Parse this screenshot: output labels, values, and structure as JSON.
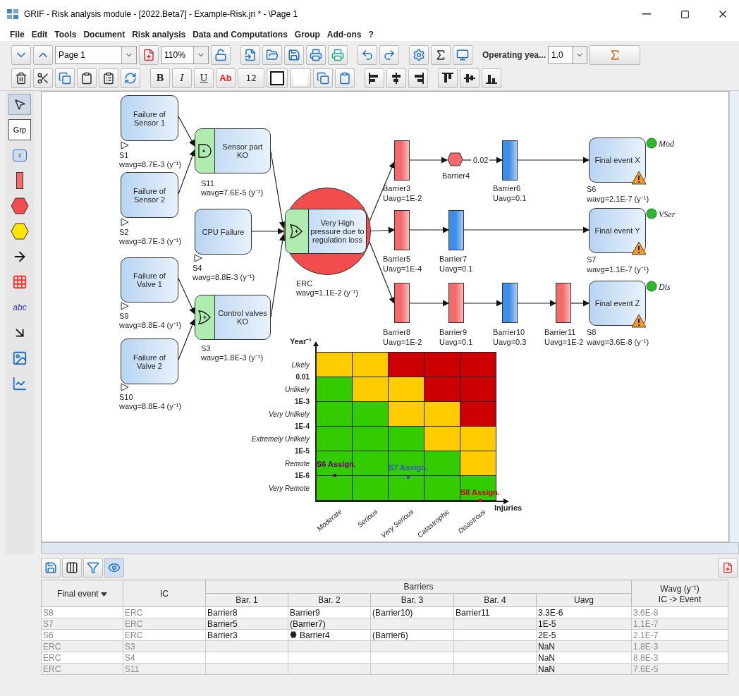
{
  "window": {
    "title": "GRIF - Risk analysis module - [2022.Beta7] - Example-Risk.jri *  - \\Page 1"
  },
  "menu": [
    "File",
    "Edit",
    "Tools",
    "Document",
    "Risk analysis",
    "Data and Computations",
    "Group",
    "Add-ons",
    "?"
  ],
  "toolbar": {
    "page": "Page 1",
    "zoom": "110%",
    "operating_label": "Operating yea...",
    "operating_value": "1.0",
    "bold": "B",
    "italic": "I",
    "underline": "U",
    "text_color": "Ab",
    "font_size": "12"
  },
  "palette": {
    "group": "Grp",
    "block": "1",
    "text": "abc"
  },
  "diagram": {
    "events": [
      {
        "title": "Failure of Sensor 1",
        "id_label": "S1",
        "value": "wavg=8.7E-3 (y⁻¹)"
      },
      {
        "title": "Failure of Sensor 2",
        "id_label": "S2",
        "value": "wavg=8.7E-3 (y⁻¹)"
      },
      {
        "title": "CPU Failure",
        "id_label": "S4",
        "value": "wavg=8.8E-3 (y⁻¹)"
      },
      {
        "title": "Failure of Valve 1",
        "id_label": "S9",
        "value": "wavg=8.8E-4 (y⁻¹)"
      },
      {
        "title": "Failure of Valve 2",
        "id_label": "S10",
        "value": "wavg=8.8E-4 (y⁻¹)"
      }
    ],
    "gates": [
      {
        "title": "Sensor part KO",
        "id_label": "S11",
        "value": "wavg=7.6E-5 (y⁻¹)",
        "kind": "and"
      },
      {
        "title": "Control valves KO",
        "id_label": "S3",
        "value": "wavg=1.8E-3 (y⁻¹)",
        "kind": "or"
      }
    ],
    "central_event": {
      "title": "Very High pressure due to regulation loss",
      "id_label": "ERC",
      "value": "wavg=1.1E-2 (y⁻¹)",
      "kind": "or"
    },
    "barriers": [
      {
        "name": "Barrier3",
        "value": "Uavg=1E-2",
        "kind": "rect",
        "color": "#f26b6b"
      },
      {
        "name": "Barrier4",
        "kind": "hexagon",
        "color": "#f26b6b",
        "edge_label": "0.02"
      },
      {
        "name": "Barrier6",
        "value": "Uavg=0.1",
        "kind": "rect",
        "color": "#3d8ee8"
      },
      {
        "name": "Barrier5",
        "value": "Uavg=1E-4",
        "kind": "rect",
        "color": "#f26b6b"
      },
      {
        "name": "Barrier7",
        "value": "Uavg=0.1",
        "kind": "rect",
        "color": "#3d8ee8"
      },
      {
        "name": "Barrier8",
        "value": "Uavg=1E-2",
        "kind": "rect",
        "color": "#f26b6b"
      },
      {
        "name": "Barrier9",
        "value": "Uavg=0.1",
        "kind": "rect",
        "color": "#f26b6b"
      },
      {
        "name": "Barrier10",
        "value": "Uavg=0.3",
        "kind": "rect",
        "color": "#3d8ee8"
      },
      {
        "name": "Barrier11",
        "value": "Uavg=1E-2",
        "kind": "rect",
        "color": "#f26b6b"
      }
    ],
    "final_events": [
      {
        "title": "Final event X",
        "id_label": "S6",
        "value": "wavg=2.1E-7 (y⁻¹)",
        "severity": "Mod",
        "warning": true
      },
      {
        "title": "Final event Y",
        "id_label": "S7",
        "value": "wavg=1.1E-7 (y⁻¹)",
        "severity": "VSer",
        "warning": true
      },
      {
        "title": "Final event Z",
        "id_label": "S8",
        "value": "wavg=3.6E-8 (y⁻¹)",
        "severity": "Dis",
        "warning": true
      }
    ]
  },
  "matrix": {
    "y_title": "Year⁻¹",
    "x_title": "Injuries",
    "rows": [
      {
        "label": "Likely",
        "cells": [
          {
            "color": "#ffcc00"
          },
          {
            "color": "#ffcc00"
          },
          {
            "color": "#cc0000"
          },
          {
            "color": "#cc0000"
          },
          {
            "color": "#cc0000"
          }
        ]
      },
      {
        "label": "Unlikely",
        "cells": [
          {
            "color": "#33cc00"
          },
          {
            "color": "#ffcc00"
          },
          {
            "color": "#ffcc00"
          },
          {
            "color": "#cc0000"
          },
          {
            "color": "#cc0000"
          }
        ]
      },
      {
        "label": "Very Unlikely",
        "cells": [
          {
            "color": "#33cc00"
          },
          {
            "color": "#33cc00"
          },
          {
            "color": "#ffcc00"
          },
          {
            "color": "#ffcc00"
          },
          {
            "color": "#cc0000"
          }
        ]
      },
      {
        "label": "Extremely Unlikely",
        "cells": [
          {
            "color": "#33cc00"
          },
          {
            "color": "#33cc00"
          },
          {
            "color": "#33cc00"
          },
          {
            "color": "#ffcc00"
          },
          {
            "color": "#ffcc00"
          }
        ]
      },
      {
        "label": "Remote",
        "cells": [
          {
            "color": "#33cc00"
          },
          {
            "color": "#33cc00"
          },
          {
            "color": "#33cc00"
          },
          {
            "color": "#33cc00"
          },
          {
            "color": "#ffcc00"
          }
        ]
      },
      {
        "label": "Very Remote",
        "cells": [
          {
            "color": "#33cc00"
          },
          {
            "color": "#33cc00"
          },
          {
            "color": "#33cc00"
          },
          {
            "color": "#33cc00"
          },
          {
            "color": "#33cc00"
          }
        ]
      }
    ],
    "ticks": [
      "0.01",
      "1E-3",
      "1E-4",
      "1E-5",
      "1E-6"
    ],
    "columns": [
      "Moderate",
      "Serious",
      "Very Serious",
      "Catastrophic",
      "Disastrous"
    ],
    "assignments": [
      {
        "label": "S6 Assign.",
        "color": "#660066"
      },
      {
        "label": "S7 Assign.",
        "color": "#3355cc"
      },
      {
        "label": "S8 Assign.",
        "color": "#cc0000"
      }
    ]
  },
  "table": {
    "headers": {
      "final_event": "Final event",
      "ic": "IC",
      "barriers": "Barriers",
      "bars": [
        "Bar. 1",
        "Bar. 2",
        "Bar. 3",
        "Bar. 4"
      ],
      "uavg": "Uavg",
      "wavg": [
        "Wavg (y⁻¹)",
        "IC -> Event"
      ]
    },
    "rows": [
      {
        "final_event": "S8",
        "ic": "ERC",
        "bars": [
          {
            "name": "Barrier8",
            "kind": "plain"
          },
          {
            "name": "Barrier9",
            "kind": "plain"
          },
          {
            "name": "(Barrier10)",
            "kind": "plain"
          },
          {
            "name": "Barrier11",
            "kind": "plain"
          }
        ],
        "uavg": "3.3E-6",
        "wavg": "3.6E-8"
      },
      {
        "final_event": "S7",
        "ic": "ERC",
        "bars": [
          {
            "name": "Barrier5",
            "kind": "plain"
          },
          {
            "name": "(Barrier7)",
            "kind": "plain"
          }
        ],
        "uavg": "1E-5",
        "wavg": "1.1E-7"
      },
      {
        "final_event": "S6",
        "ic": "ERC",
        "bars": [
          {
            "name": "Barrier3",
            "kind": "plain"
          },
          {
            "name": "Barrier4",
            "kind": "hexagon"
          },
          {
            "name": "(Barrier6)",
            "kind": "plain"
          }
        ],
        "uavg": "2E-5",
        "wavg": "2.1E-7"
      },
      {
        "final_event": "ERC",
        "ic": "S3",
        "uavg": "NaN",
        "wavg": "1.8E-3"
      },
      {
        "final_event": "ERC",
        "ic": "S4",
        "uavg": "NaN",
        "wavg": "8.8E-3"
      },
      {
        "final_event": "ERC",
        "ic": "S11",
        "uavg": "NaN",
        "wavg": "7.6E-5"
      }
    ]
  }
}
